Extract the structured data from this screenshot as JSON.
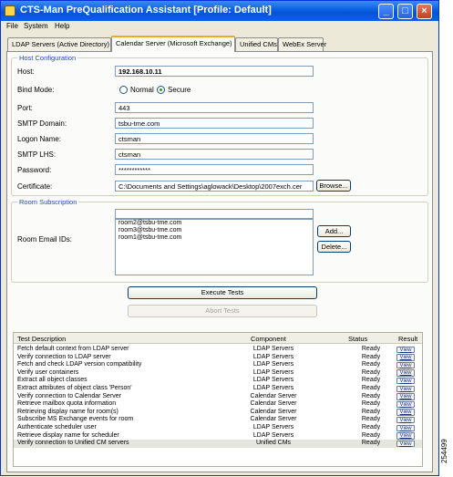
{
  "window": {
    "title": "CTS-Man PreQualification Assistant [Profile: Default]",
    "controls": [
      "_",
      "□",
      "×"
    ]
  },
  "menu": [
    "File",
    "System",
    "Help"
  ],
  "tabs": [
    {
      "label": "LDAP Servers (Active Directory)",
      "active": false
    },
    {
      "label": "Calendar Server (Microsoft Exchange)",
      "active": true
    },
    {
      "label": "Unified CMs",
      "active": false
    },
    {
      "label": "WebEx Server",
      "active": false
    }
  ],
  "host_config": {
    "legend": "Host Configuration",
    "host_label": "Host:",
    "host_value": "192.168.10.11",
    "bind_mode_label": "Bind Mode:",
    "bind_normal": "Normal",
    "bind_secure": "Secure",
    "bind_selected": "Secure",
    "port_label": "Port:",
    "port_value": "443",
    "smtp_domain_label": "SMTP Domain:",
    "smtp_domain_value": "tsbu-tme.com",
    "logon_label": "Logon Name:",
    "logon_value": "ctsman",
    "smtp_lhs_label": "SMTP LHS:",
    "smtp_lhs_value": "ctsman",
    "password_label": "Password:",
    "password_value": "************",
    "certificate_label": "Certificate:",
    "certificate_value": "C:\\Documents and Settings\\aglowack\\Desktop\\2007exch.cer",
    "browse_label": "Browse..."
  },
  "room_subscription": {
    "legend": "Room Subscription",
    "label": "Room Email IDs:",
    "input_value": "",
    "emails": [
      "room2@tsbu-tme.com",
      "room3@tsbu-tme.com",
      "room1@tsbu-tme.com"
    ],
    "add_label": "Add...",
    "delete_label": "Delete..."
  },
  "actions": {
    "execute_label": "Execute Tests",
    "abort_label": "Abort Tests"
  },
  "results": {
    "columns": [
      "Test Description",
      "Component",
      "Status",
      "Result"
    ],
    "rows": [
      {
        "desc": "Fetch default context from LDAP server",
        "component": "LDAP Servers",
        "status": "Ready",
        "result": "View"
      },
      {
        "desc": "Verify connection to LDAP server",
        "component": "LDAP Servers",
        "status": "Ready",
        "result": "View"
      },
      {
        "desc": "Fetch and check LDAP version compatibility",
        "component": "LDAP Servers",
        "status": "Ready",
        "result": "View"
      },
      {
        "desc": "Verify user containers",
        "component": "LDAP Servers",
        "status": "Ready",
        "result": "View"
      },
      {
        "desc": "Extract all object classes",
        "component": "LDAP Servers",
        "status": "Ready",
        "result": "View"
      },
      {
        "desc": "Extract attributes of object class 'Person'",
        "component": "LDAP Servers",
        "status": "Ready",
        "result": "View"
      },
      {
        "desc": "Verify connection to Calendar Server",
        "component": "Calendar Server",
        "status": "Ready",
        "result": "View"
      },
      {
        "desc": "Retrieve mailbox quota information",
        "component": "Calendar Server",
        "status": "Ready",
        "result": "View"
      },
      {
        "desc": "Retrieving display name for room(s)",
        "component": "Calendar Server",
        "status": "Ready",
        "result": "View"
      },
      {
        "desc": "Subscribe MS Exchange events for room",
        "component": "Calendar Server",
        "status": "Ready",
        "result": "View"
      },
      {
        "desc": "Authenticate scheduler user",
        "component": "LDAP Servers",
        "status": "Ready",
        "result": "View"
      },
      {
        "desc": "Retrieve display name for scheduler",
        "component": "LDAP Servers",
        "status": "Ready",
        "result": "View"
      },
      {
        "desc": "Verify connection to Unified CM servers",
        "component": "Unified CMs",
        "status": "Ready",
        "result": "View"
      }
    ],
    "selected_row": 12
  },
  "figure_number": "254499"
}
